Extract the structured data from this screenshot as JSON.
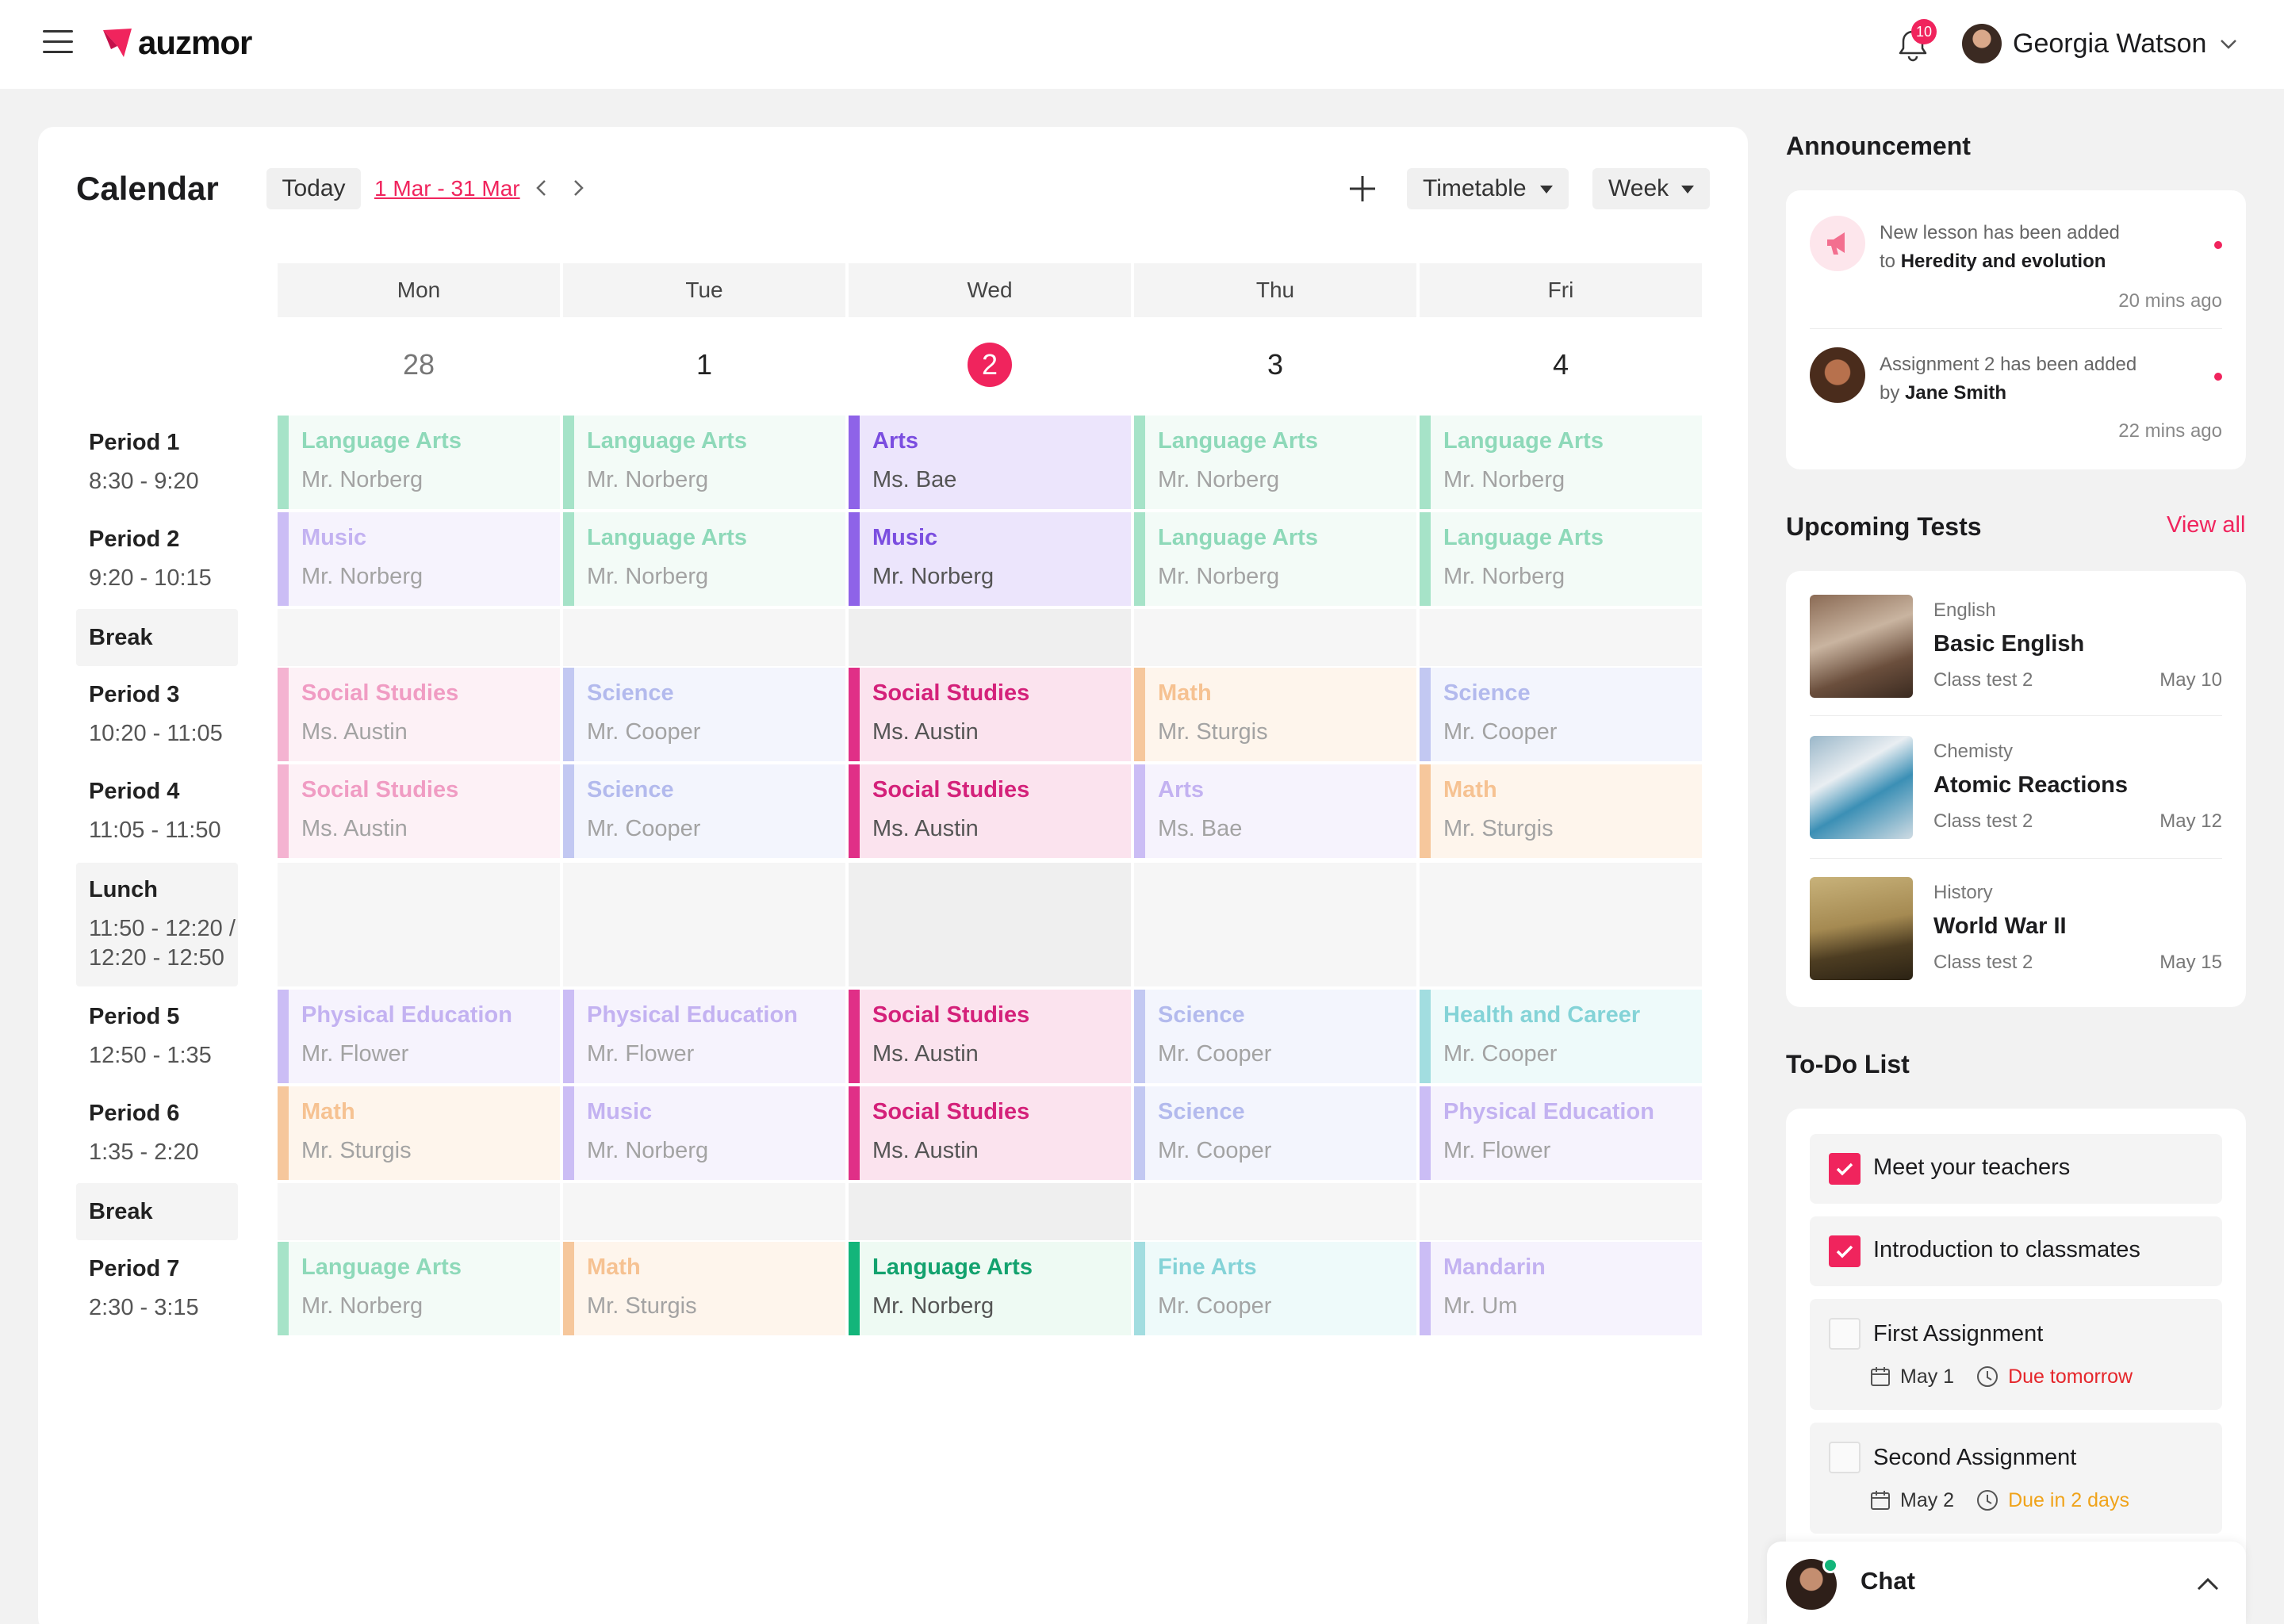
{
  "brand": {
    "name": "auzmor",
    "accent": "#f0245d"
  },
  "header": {
    "notifications_count": "10",
    "user_name": "Georgia Watson"
  },
  "calendar": {
    "title": "Calendar",
    "today_label": "Today",
    "range_label": "1 Mar - 31 Mar",
    "view_select": "Timetable",
    "period_select": "Week",
    "days": [
      {
        "name": "Mon",
        "date": "28"
      },
      {
        "name": "Tue",
        "date": "1"
      },
      {
        "name": "Wed",
        "date": "2"
      },
      {
        "name": "Thu",
        "date": "3"
      },
      {
        "name": "Fri",
        "date": "4"
      }
    ],
    "periods": [
      {
        "name": "Period 1",
        "time": "8:30 - 9:20"
      },
      {
        "name": "Period 2",
        "time": "9:20 - 10:15"
      },
      {
        "name": "Break",
        "time": ""
      },
      {
        "name": "Period 3",
        "time": "10:20 - 11:05"
      },
      {
        "name": "Period 4",
        "time": "11:05 - 11:50"
      },
      {
        "name": "Lunch",
        "time": "11:50 - 12:20 /",
        "time2": "12:20 - 12:50"
      },
      {
        "name": "Period 5",
        "time": "12:50 - 1:35"
      },
      {
        "name": "Period 6",
        "time": "1:35 - 2:20"
      },
      {
        "name": "Break",
        "time": ""
      },
      {
        "name": "Period 7",
        "time": "2:30 - 3:15"
      }
    ],
    "schedule": [
      [
        {
          "subject": "Language Arts",
          "teacher": "Mr. Norberg",
          "color": "green"
        },
        {
          "subject": "Music",
          "teacher": "Mr. Norberg",
          "color": "purple"
        },
        {
          "subject": "Social Studies",
          "teacher": "Ms. Austin",
          "color": "pink"
        },
        {
          "subject": "Social Studies",
          "teacher": "Ms. Austin",
          "color": "pink"
        },
        {
          "subject": "Physical Education",
          "teacher": "Mr. Flower",
          "color": "purple"
        },
        {
          "subject": "Math",
          "teacher": "Mr. Sturgis",
          "color": "orange"
        },
        {
          "subject": "Language Arts",
          "teacher": "Mr. Norberg",
          "color": "green"
        }
      ],
      [
        {
          "subject": "Language Arts",
          "teacher": "Mr. Norberg",
          "color": "green"
        },
        {
          "subject": "Language Arts",
          "teacher": "Mr. Norberg",
          "color": "green"
        },
        {
          "subject": "Science",
          "teacher": "Mr. Cooper",
          "color": "blue"
        },
        {
          "subject": "Science",
          "teacher": "Mr. Cooper",
          "color": "blue"
        },
        {
          "subject": "Physical Education",
          "teacher": "Mr. Flower",
          "color": "purple"
        },
        {
          "subject": "Music",
          "teacher": "Mr. Norberg",
          "color": "purple"
        },
        {
          "subject": "Math",
          "teacher": "Mr. Sturgis",
          "color": "orange"
        }
      ],
      [
        {
          "subject": "Arts",
          "teacher": "Ms. Bae",
          "color": "purple"
        },
        {
          "subject": "Music",
          "teacher": "Mr. Norberg",
          "color": "purple"
        },
        {
          "subject": "Social Studies",
          "teacher": "Ms. Austin",
          "color": "pink"
        },
        {
          "subject": "Social Studies",
          "teacher": "Ms. Austin",
          "color": "pink"
        },
        {
          "subject": "Social Studies",
          "teacher": "Ms. Austin",
          "color": "pink"
        },
        {
          "subject": "Social Studies",
          "teacher": "Ms. Austin",
          "color": "pink"
        },
        {
          "subject": "Language Arts",
          "teacher": "Mr. Norberg",
          "color": "green"
        }
      ],
      [
        {
          "subject": "Language Arts",
          "teacher": "Mr. Norberg",
          "color": "green"
        },
        {
          "subject": "Language Arts",
          "teacher": "Mr. Norberg",
          "color": "green"
        },
        {
          "subject": "Math",
          "teacher": "Mr. Sturgis",
          "color": "orange"
        },
        {
          "subject": "Arts",
          "teacher": "Ms. Bae",
          "color": "purple"
        },
        {
          "subject": "Science",
          "teacher": "Mr. Cooper",
          "color": "blue"
        },
        {
          "subject": "Science",
          "teacher": "Mr. Cooper",
          "color": "blue"
        },
        {
          "subject": "Fine Arts",
          "teacher": "Mr. Cooper",
          "color": "teal"
        }
      ],
      [
        {
          "subject": "Language Arts",
          "teacher": "Mr. Norberg",
          "color": "green"
        },
        {
          "subject": "Language Arts",
          "teacher": "Mr. Norberg",
          "color": "green"
        },
        {
          "subject": "Science",
          "teacher": "Mr. Cooper",
          "color": "blue"
        },
        {
          "subject": "Math",
          "teacher": "Mr. Sturgis",
          "color": "orange"
        },
        {
          "subject": "Health and Career",
          "teacher": "Mr. Cooper",
          "color": "teal"
        },
        {
          "subject": "Physical Education",
          "teacher": "Mr. Flower",
          "color": "purple"
        },
        {
          "subject": "Mandarin",
          "teacher": "Mr. Um",
          "color": "purple"
        }
      ]
    ]
  },
  "announcements": {
    "title": "Announcement",
    "items": [
      {
        "line1": "New lesson has been added",
        "prefix": "to",
        "bold": "Heredity and evolution",
        "time": "20 mins ago"
      },
      {
        "line1": "Assignment 2 has been added",
        "prefix": "by",
        "bold": "Jane Smith",
        "time": "22 mins ago"
      }
    ]
  },
  "tests": {
    "title": "Upcoming Tests",
    "view_all": "View all",
    "items": [
      {
        "category": "English",
        "title": "Basic English",
        "sub": "Class test 2",
        "date": "May 10"
      },
      {
        "category": "Chemisty",
        "title": "Atomic Reactions",
        "sub": "Class test 2",
        "date": "May 12"
      },
      {
        "category": "History",
        "title": "World War II",
        "sub": "Class test 2",
        "date": "May 15"
      }
    ]
  },
  "todo": {
    "title": "To-Do List",
    "items": [
      {
        "label": "Meet your teachers",
        "checked": true
      },
      {
        "label": "Introduction to classmates",
        "checked": true
      },
      {
        "label": "First Assignment",
        "checked": false,
        "date": "May 1",
        "due": "Due tomorrow",
        "due_color": "#e5262b"
      },
      {
        "label": "Second Assignment",
        "checked": false,
        "date": "May 2",
        "due": "Due in 2 days",
        "due_color": "#f0a31a"
      }
    ]
  },
  "chat": {
    "label": "Chat"
  }
}
